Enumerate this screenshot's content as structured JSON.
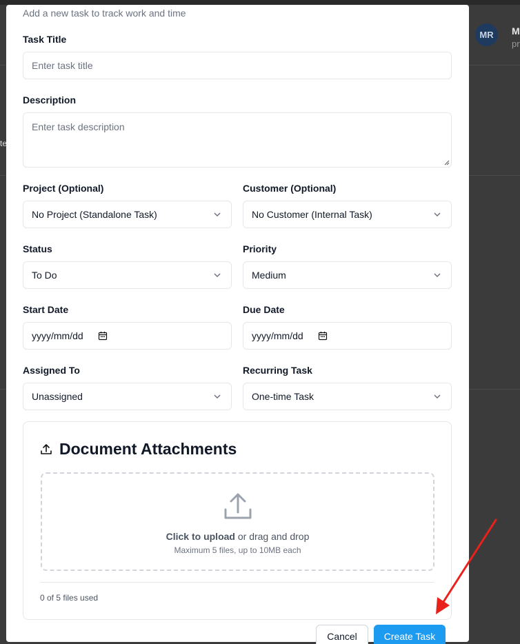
{
  "background": {
    "avatar_initials": "MR",
    "user_name_partial": "M",
    "user_sub_partial": "pr",
    "edge_text": "te"
  },
  "modal": {
    "subtitle": "Add a new task to track work and time",
    "task_title": {
      "label": "Task Title",
      "placeholder": "Enter task title"
    },
    "description": {
      "label": "Description",
      "placeholder": "Enter task description"
    },
    "project": {
      "label": "Project (Optional)",
      "value": "No Project (Standalone Task)"
    },
    "customer": {
      "label": "Customer (Optional)",
      "value": "No Customer (Internal Task)"
    },
    "status": {
      "label": "Status",
      "value": "To Do"
    },
    "priority": {
      "label": "Priority",
      "value": "Medium"
    },
    "start_date": {
      "label": "Start Date",
      "value": "yyyy/mm/dd"
    },
    "due_date": {
      "label": "Due Date",
      "value": "yyyy/mm/dd"
    },
    "assigned_to": {
      "label": "Assigned To",
      "value": "Unassigned"
    },
    "recurring": {
      "label": "Recurring Task",
      "value": "One-time Task"
    },
    "attachments": {
      "title": "Document Attachments",
      "click_text": "Click to upload",
      "drag_text": " or drag and drop",
      "limit_text": "Maximum 5 files, up to 10MB each",
      "files_used": "0 of 5 files used"
    },
    "buttons": {
      "cancel": "Cancel",
      "create": "Create Task"
    }
  },
  "colors": {
    "accent": "#1d9bf0",
    "annotation_arrow": "#e8211b",
    "overlay": "#3b3b3b"
  }
}
